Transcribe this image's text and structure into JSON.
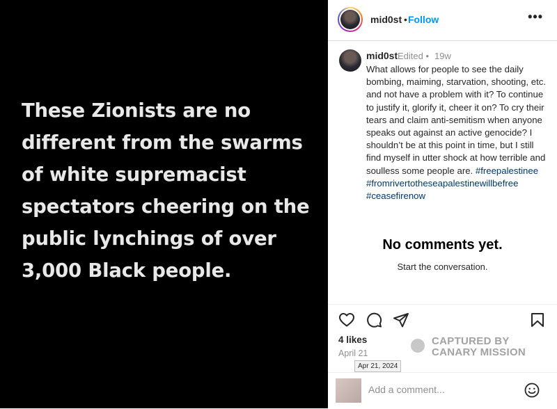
{
  "media": {
    "text": "These Zionists are no different from the swarms of white supremacist spectators cheering on the public lynchings of over 3,000 Black people."
  },
  "header": {
    "username": "mid0st",
    "separator": "•",
    "follow_label": "Follow",
    "more_label": "•••"
  },
  "caption": {
    "username": "mid0st",
    "edited_label": "Edited",
    "separator": "•",
    "time": "19w",
    "body": "What allows for people to see the daily bombing, maiming, starvation, shooting, etc. and not have a problem with it? To continue to justify it, glorify it, cheer it on? To cry their tears and claim anti-semitism when anyone speaks out against an active genocide? I shouldn’t be at this point in time, but I still find myself in utter shock at how terrible and soulless some people are. ",
    "hashtags": [
      "#freepalestinee",
      "#fromrivertotheseapalestinewillbefree",
      "#ceasefirenow"
    ]
  },
  "comments": {
    "empty_title": "No comments yet.",
    "empty_subtitle": "Start the conversation."
  },
  "actions": {
    "like_icon": "heart-icon",
    "comment_icon": "comment-icon",
    "share_icon": "send-icon",
    "save_icon": "bookmark-icon"
  },
  "stats": {
    "likes": "4 likes",
    "date": "April 21",
    "date_tooltip": "Apr 21, 2024"
  },
  "watermark": {
    "line1": "CAPTURED BY",
    "line2": "CANARY MISSION"
  },
  "comment_box": {
    "placeholder": "Add a comment...",
    "emoji_icon": "emoji-icon"
  },
  "colors": {
    "accent": "#0095f6",
    "hashtag": "#00376b",
    "muted": "#8e8e8e",
    "media_bg": "#000000"
  }
}
